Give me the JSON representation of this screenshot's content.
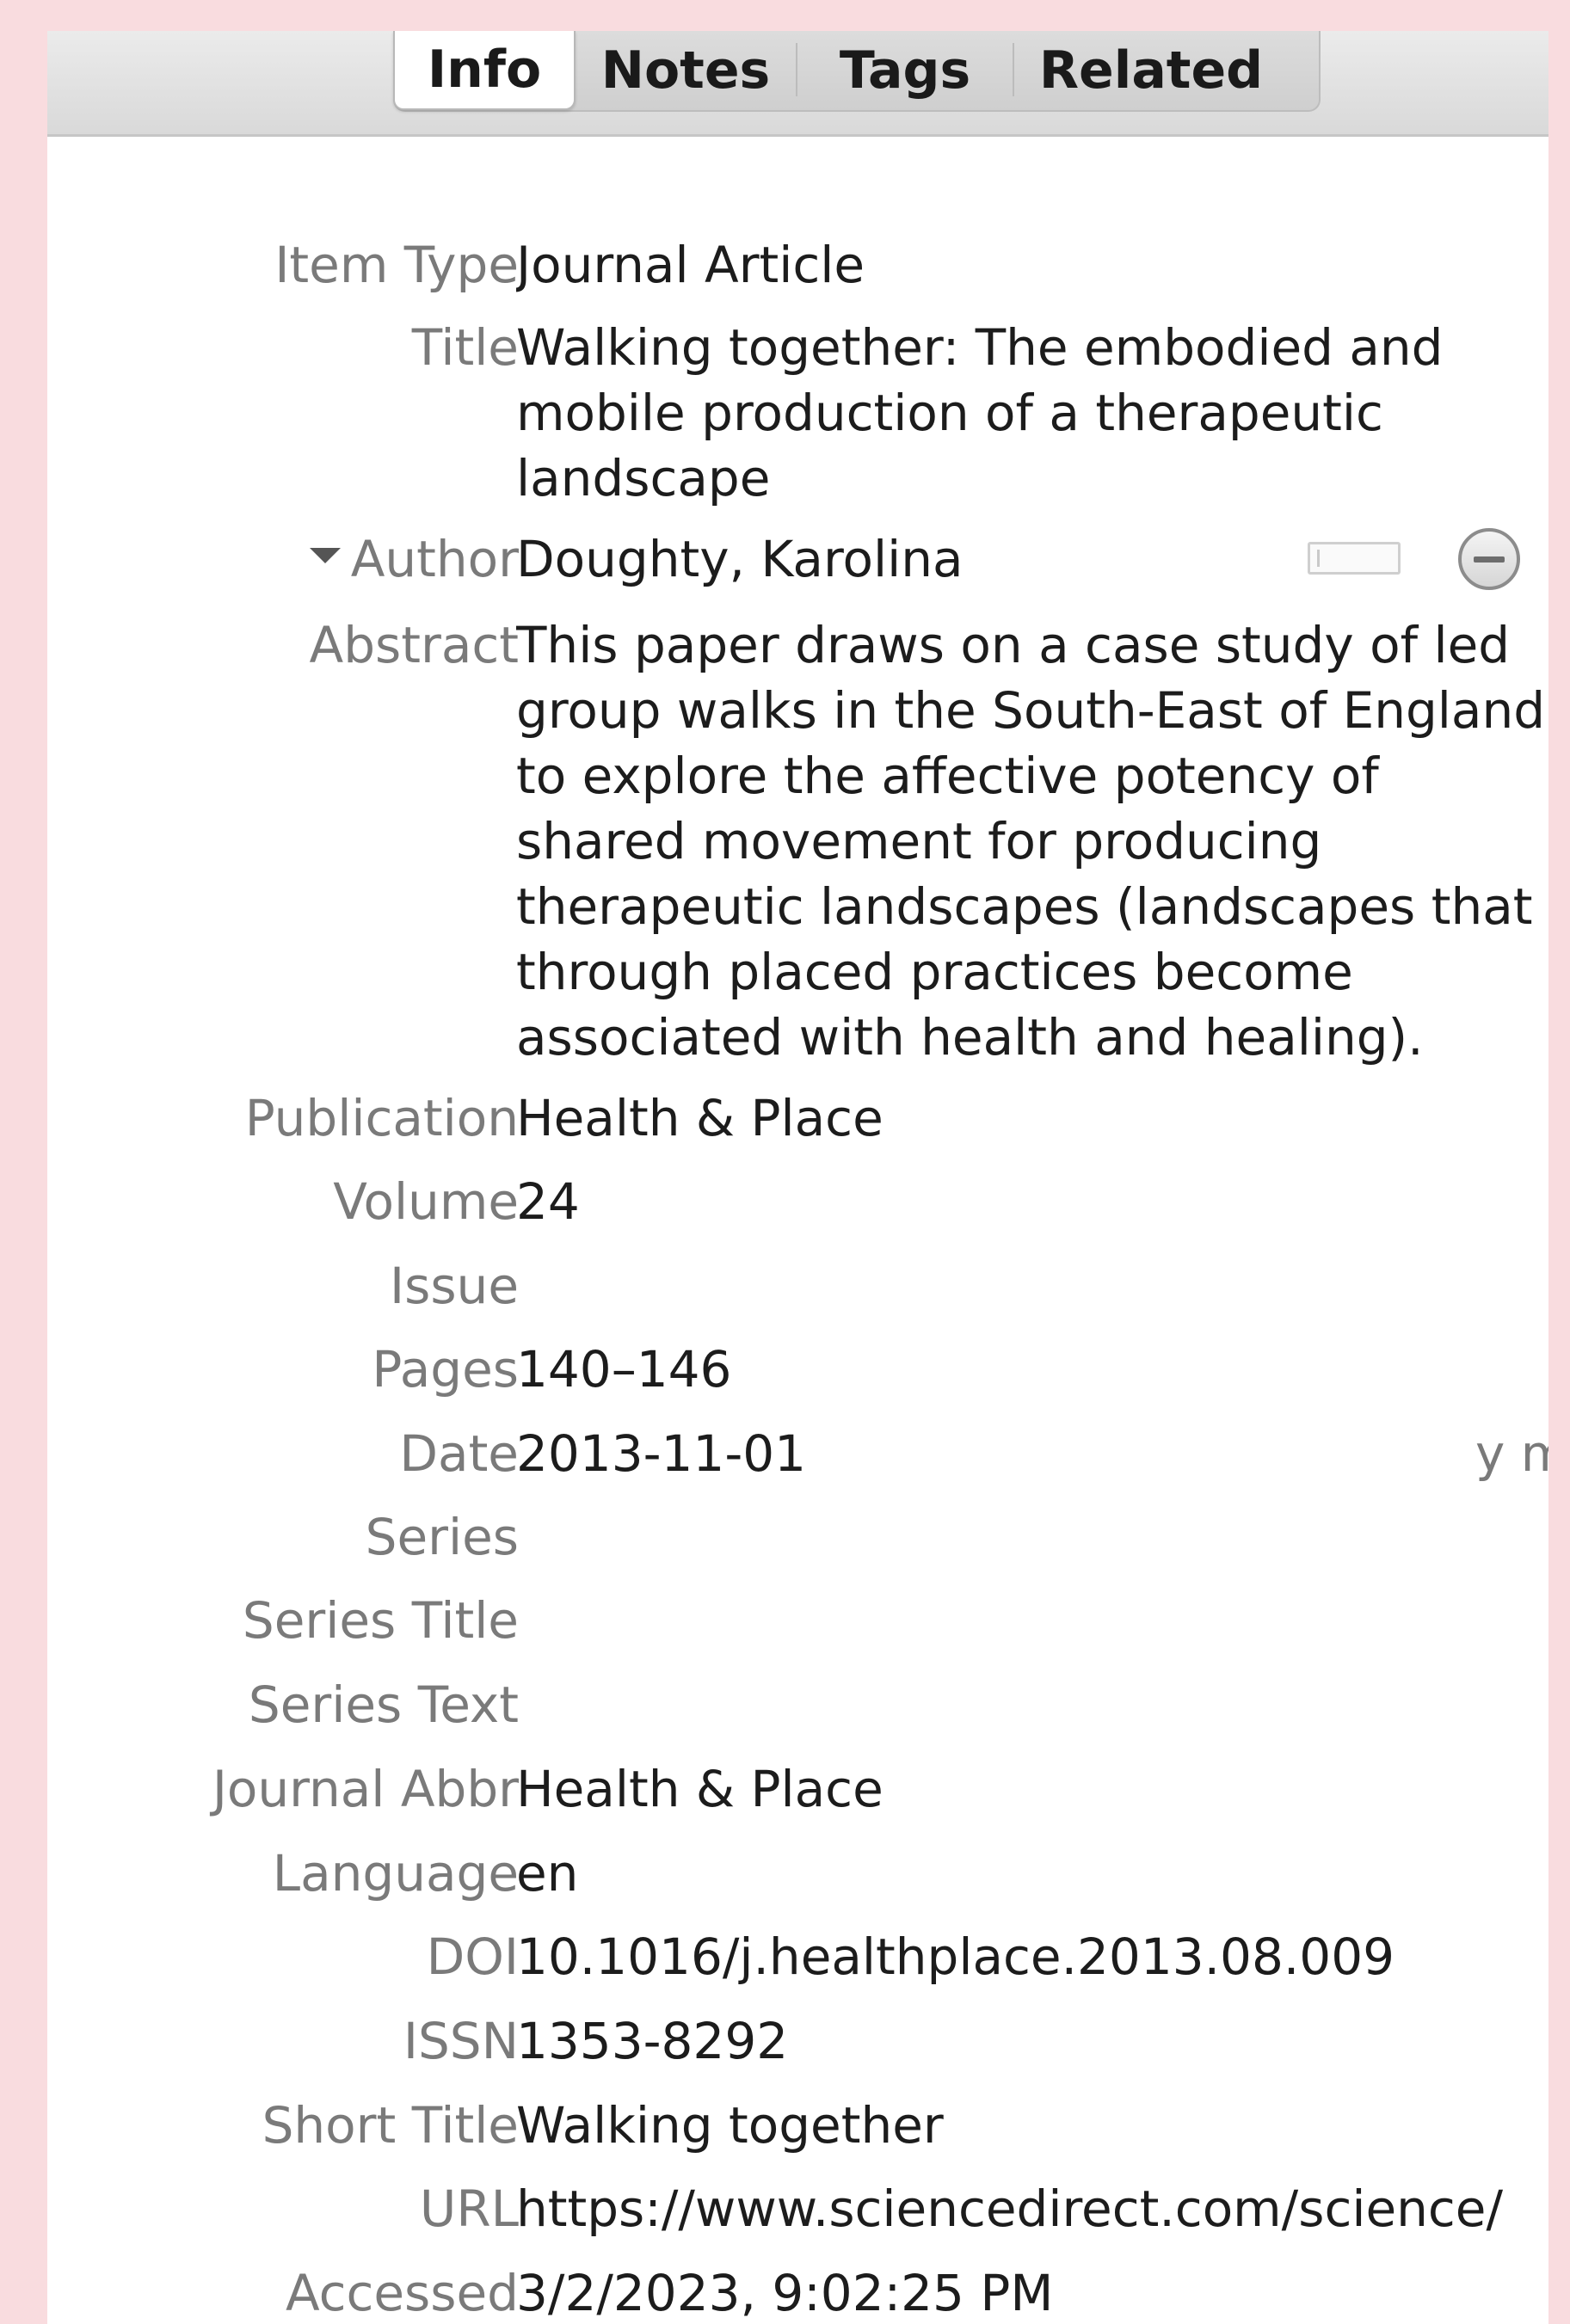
{
  "tabs": [
    {
      "label": "Info",
      "active": true
    },
    {
      "label": "Notes",
      "active": false
    },
    {
      "label": "Tags",
      "active": false
    },
    {
      "label": "Related",
      "active": false
    }
  ],
  "fields": {
    "item_type": {
      "label": "Item Type",
      "value": "Journal Article"
    },
    "title": {
      "label": "Title",
      "value": "Walking together: The embodied and mobile production of a therapeutic landscape"
    },
    "author": {
      "label": "Author",
      "value": "Doughty, Karolina"
    },
    "abstract": {
      "label": "Abstract",
      "value": "This paper draws on a case study of led group walks in the South-East of England to explore the affective potency of shared movement for producing therapeutic landscapes (landscapes that through placed practices become associated with health and healing)."
    },
    "publication": {
      "label": "Publication",
      "value": "Health & Place"
    },
    "volume": {
      "label": "Volume",
      "value": "24"
    },
    "issue": {
      "label": "Issue",
      "value": ""
    },
    "pages": {
      "label": "Pages",
      "value": "140–146"
    },
    "date": {
      "label": "Date",
      "value": "2013-11-01",
      "hint": "y m"
    },
    "series": {
      "label": "Series",
      "value": ""
    },
    "series_title": {
      "label": "Series Title",
      "value": ""
    },
    "series_text": {
      "label": "Series Text",
      "value": ""
    },
    "journal_abbr": {
      "label": "Journal Abbr",
      "value": "Health & Place"
    },
    "language": {
      "label": "Language",
      "value": "en"
    },
    "doi": {
      "label": "DOI",
      "value": "10.1016/j.healthplace.2013.08.009"
    },
    "issn": {
      "label": "ISSN",
      "value": "1353-8292"
    },
    "short_title": {
      "label": "Short Title",
      "value": "Walking together"
    },
    "url": {
      "label": "URL",
      "value": "https://www.sciencedirect.com/science/"
    },
    "accessed": {
      "label": "Accessed",
      "value": "3/2/2023, 9:02:25 PM"
    }
  },
  "icons": {
    "author_expand": "triangle-down-icon",
    "remove_author": "minus-circle-icon"
  }
}
